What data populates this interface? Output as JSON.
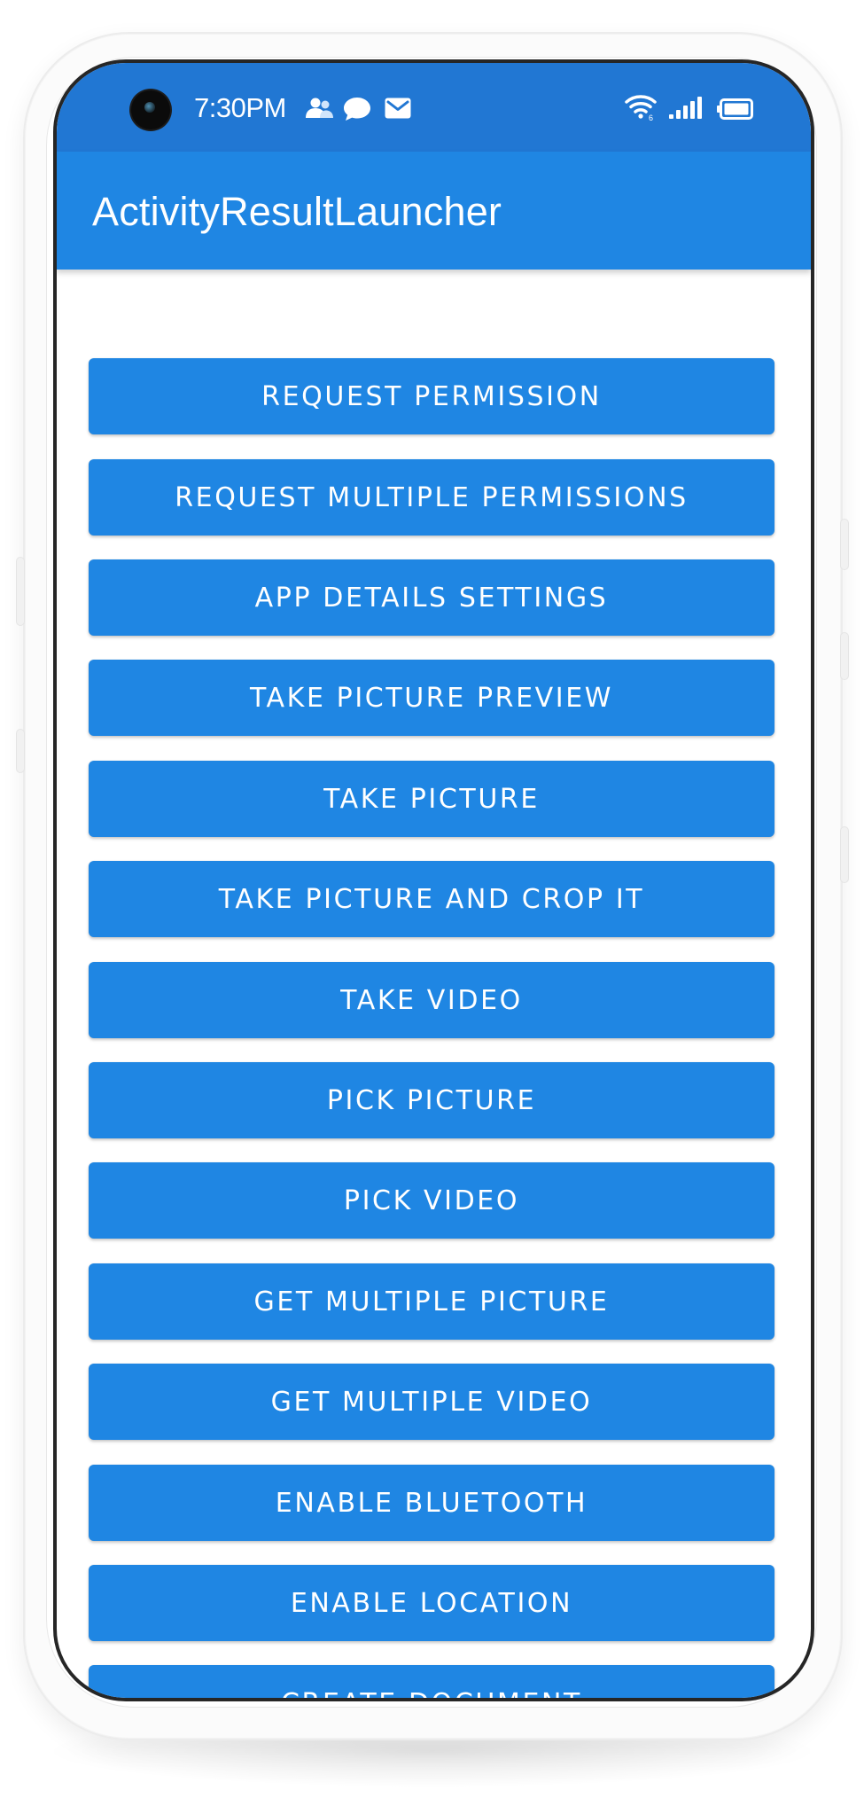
{
  "status_bar": {
    "time": "7:30PM",
    "icons": [
      "camera-cutout",
      "people-icon",
      "chat-bubble-icon",
      "mail-icon",
      "wifi-icon",
      "signal-icon",
      "battery-icon"
    ]
  },
  "app_bar": {
    "title": "ActivityResultLauncher"
  },
  "buttons": [
    {
      "label": "REQUEST PERMISSION"
    },
    {
      "label": "REQUEST MULTIPLE PERMISSIONS"
    },
    {
      "label": "APP DETAILS SETTINGS"
    },
    {
      "label": "TAKE PICTURE PREVIEW"
    },
    {
      "label": "TAKE PICTURE"
    },
    {
      "label": "TAKE PICTURE AND CROP IT"
    },
    {
      "label": "TAKE VIDEO"
    },
    {
      "label": "PICK PICTURE"
    },
    {
      "label": "PICK VIDEO"
    },
    {
      "label": "GET MULTIPLE PICTURE"
    },
    {
      "label": "GET MULTIPLE VIDEO"
    },
    {
      "label": "ENABLE BLUETOOTH"
    },
    {
      "label": "ENABLE LOCATION"
    },
    {
      "label": "CREATE DOCUMENT"
    }
  ],
  "colors": {
    "status_bar": "#2177d3",
    "primary": "#1f86e3",
    "on_primary": "#ffffff",
    "background": "#ffffff"
  }
}
